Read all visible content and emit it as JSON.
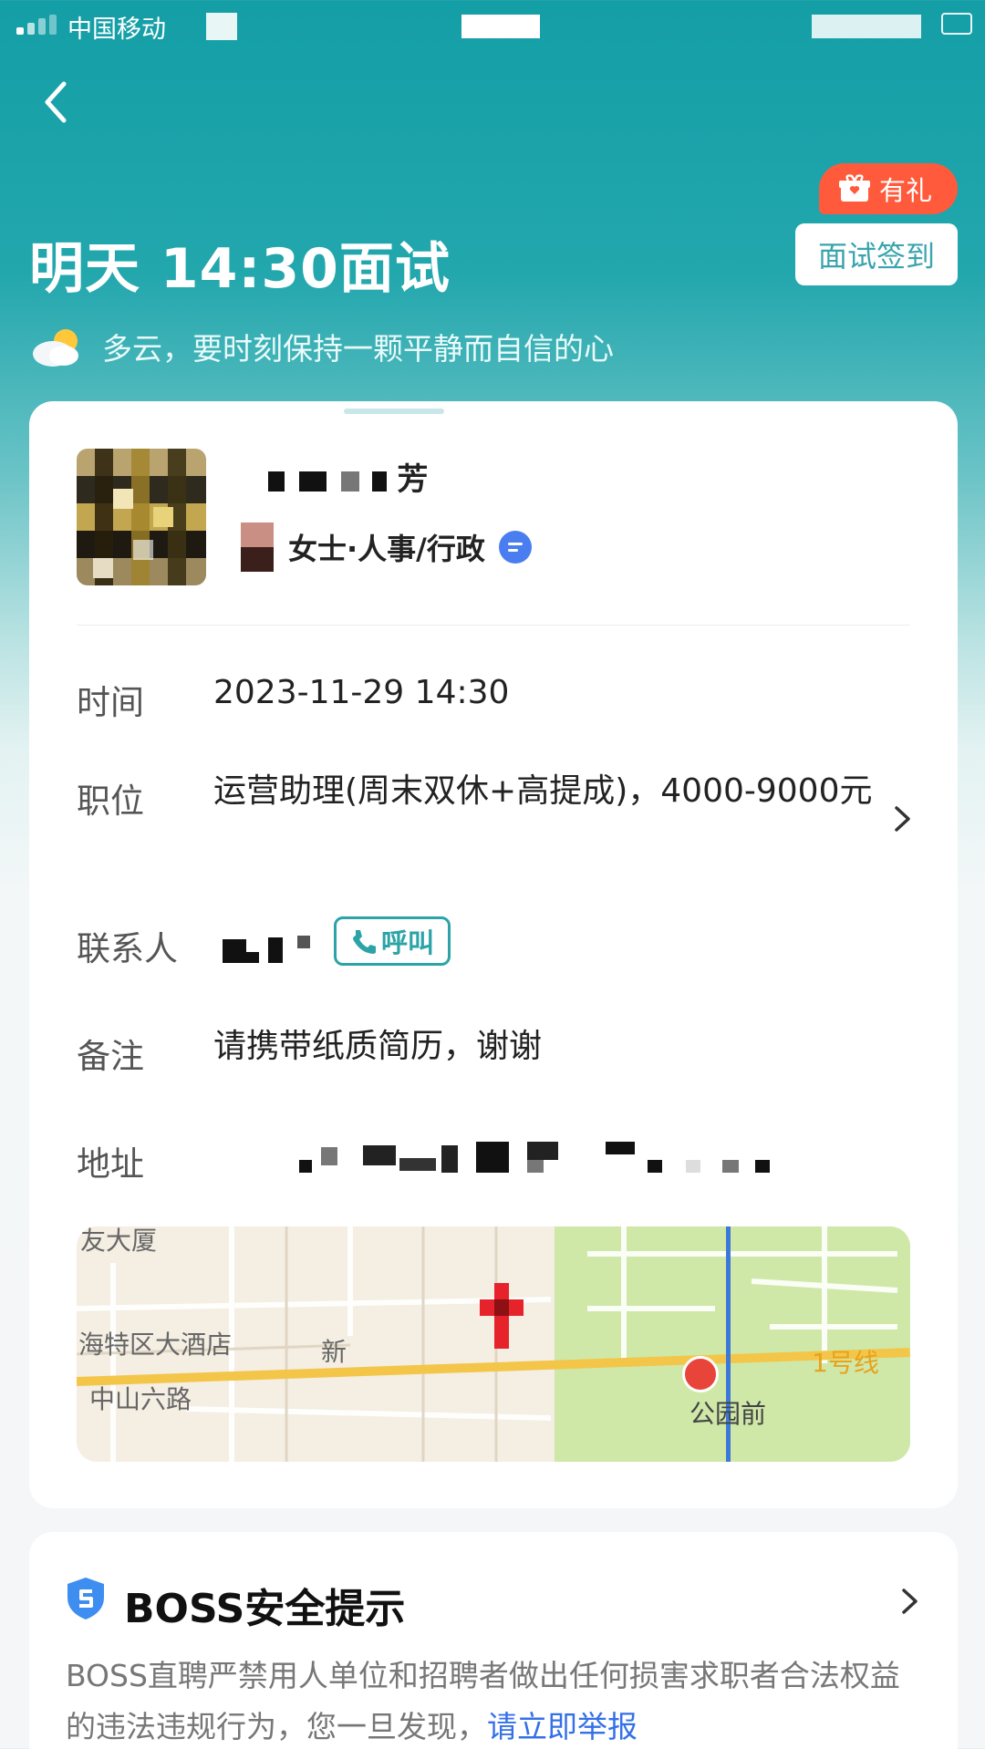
{
  "status_bar": {
    "carrier": "中国移动"
  },
  "header": {
    "gift_badge": "有礼",
    "checkin_button": "面试签到",
    "title": "明天 14:30面试",
    "weather_text": "多云，要时刻保持一颗平静而自信的心"
  },
  "interviewer": {
    "name_suffix": "芳",
    "title_suffix": "女士·人事/行政"
  },
  "details": {
    "time_label": "时间",
    "time_value": "2023-11-29 14:30",
    "position_label": "职位",
    "position_value": "运营助理(周末双休+高提成)，4000-9000元",
    "contact_label": "联系人",
    "call_button": "呼叫",
    "note_label": "备注",
    "note_value": "请携带纸质简历，谢谢",
    "address_label": "地址"
  },
  "map": {
    "labels": {
      "building": "友大厦",
      "hotel": "海特区大酒店",
      "road": "中山六路",
      "new": "新",
      "metro_line": "1号线",
      "station": "公园前"
    }
  },
  "safety": {
    "title": "BOSS安全提示",
    "text": "BOSS直聘严禁用人单位和招聘者做出任何损害求职者合法权益的违法违规行为，您一旦发现，",
    "link": "请立即举报"
  },
  "colors": {
    "header_teal": "#149ea6",
    "badge_red": "#ff5a3c",
    "accent_teal": "#2ca3a6",
    "link_blue": "#3570e8"
  }
}
